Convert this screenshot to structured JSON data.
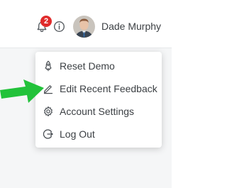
{
  "header": {
    "notification_count": "2",
    "user_name": "Dade Murphy"
  },
  "menu": {
    "items": [
      {
        "label": "Reset Demo",
        "icon": "rocket-icon"
      },
      {
        "label": "Edit Recent Feedback",
        "icon": "pencil-icon"
      },
      {
        "label": "Account Settings",
        "icon": "gear-icon"
      },
      {
        "label": "Log Out",
        "icon": "logout-icon"
      }
    ]
  },
  "colors": {
    "badge": "#e02b2b",
    "arrow": "#22c23a",
    "text": "#3c4044"
  }
}
